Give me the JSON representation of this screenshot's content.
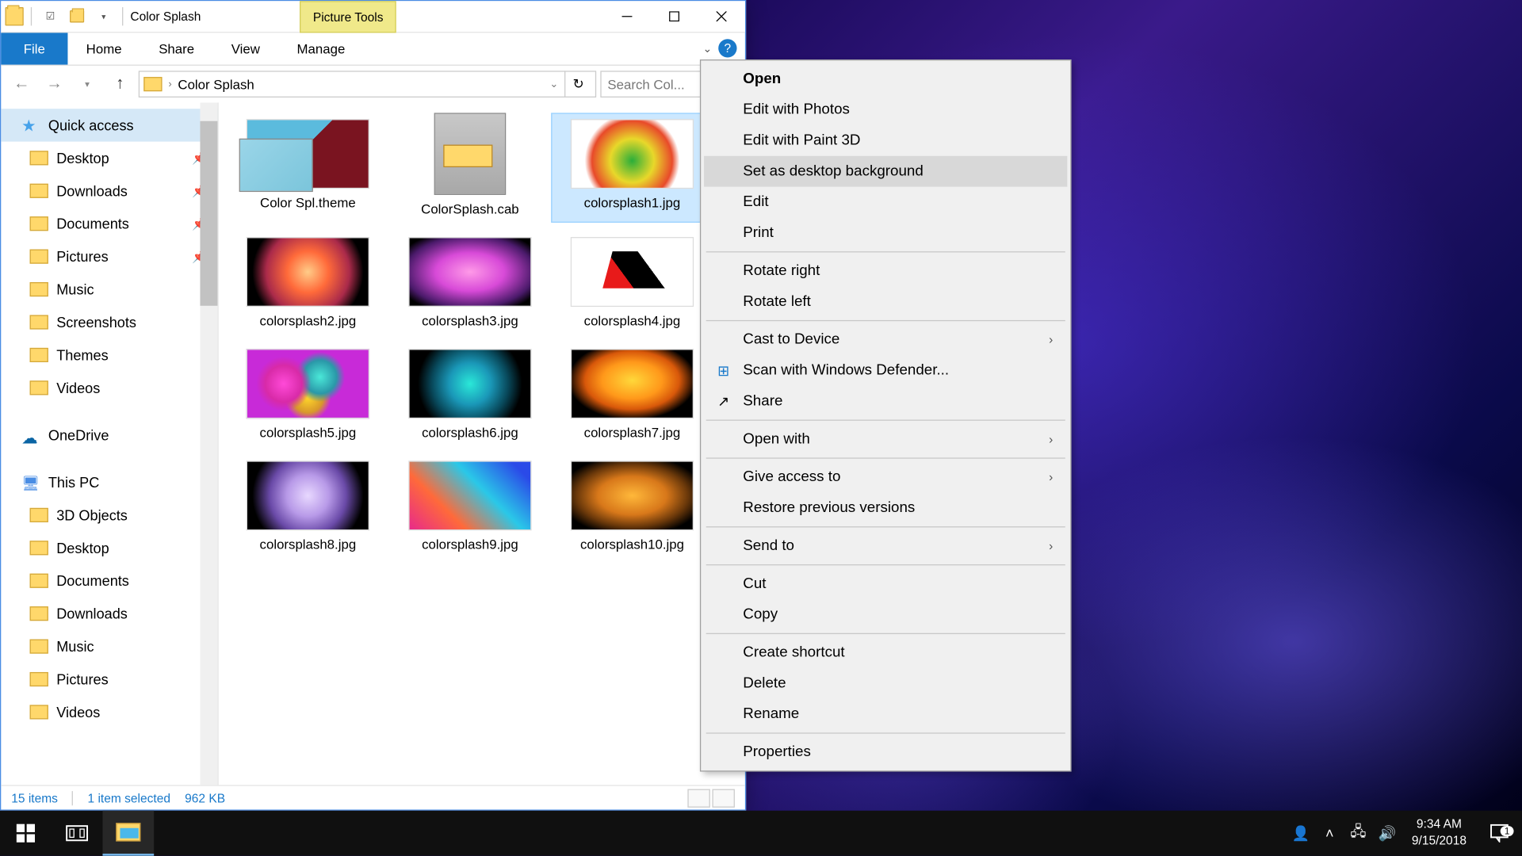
{
  "window": {
    "title": "Color Splash",
    "picture_tools": "Picture Tools"
  },
  "ribbon": {
    "file": "File",
    "tabs": [
      "Home",
      "Share",
      "View",
      "Manage"
    ]
  },
  "address": {
    "path": "Color Splash",
    "search_placeholder": "Search Col..."
  },
  "nav": {
    "quick_access": "Quick access",
    "pinned": [
      {
        "label": "Desktop"
      },
      {
        "label": "Downloads"
      },
      {
        "label": "Documents"
      },
      {
        "label": "Pictures"
      }
    ],
    "recent": [
      {
        "label": "Music"
      },
      {
        "label": "Screenshots"
      },
      {
        "label": "Themes"
      },
      {
        "label": "Videos"
      }
    ],
    "onedrive": "OneDrive",
    "this_pc": "This PC",
    "pc_items": [
      {
        "label": "3D Objects"
      },
      {
        "label": "Desktop"
      },
      {
        "label": "Documents"
      },
      {
        "label": "Downloads"
      },
      {
        "label": "Music"
      },
      {
        "label": "Pictures"
      },
      {
        "label": "Videos"
      }
    ]
  },
  "items": [
    {
      "label": "Color Spl.theme",
      "kind": "theme"
    },
    {
      "label": "ColorSplash.cab",
      "kind": "cab"
    },
    {
      "label": "colorsplash1.jpg",
      "kind": "img",
      "selected": true
    },
    {
      "label": "colorsplash2.jpg",
      "kind": "img"
    },
    {
      "label": "colorsplash3.jpg",
      "kind": "img"
    },
    {
      "label": "colorsplash4.jpg",
      "kind": "img"
    },
    {
      "label": "colorsplash5.jpg",
      "kind": "img"
    },
    {
      "label": "colorsplash6.jpg",
      "kind": "img"
    },
    {
      "label": "colorsplash7.jpg",
      "kind": "img"
    },
    {
      "label": "colorsplash8.jpg",
      "kind": "img"
    },
    {
      "label": "colorsplash9.jpg",
      "kind": "img"
    },
    {
      "label": "colorsplash10.jpg",
      "kind": "img"
    }
  ],
  "status": {
    "count": "15 items",
    "selected": "1 item selected",
    "size": "962 KB"
  },
  "ctx": {
    "open": "Open",
    "edit_photos": "Edit with Photos",
    "edit_paint3d": "Edit with Paint 3D",
    "set_bg": "Set as desktop background",
    "edit": "Edit",
    "print": "Print",
    "rot_r": "Rotate right",
    "rot_l": "Rotate left",
    "cast": "Cast to Device",
    "defender": "Scan with Windows Defender...",
    "share": "Share",
    "open_with": "Open with",
    "give_access": "Give access to",
    "restore": "Restore previous versions",
    "send_to": "Send to",
    "cut": "Cut",
    "copy": "Copy",
    "shortcut": "Create shortcut",
    "delete": "Delete",
    "rename": "Rename",
    "properties": "Properties"
  },
  "tray": {
    "time": "9:34 AM",
    "date": "9/15/2018",
    "notif_count": "1"
  }
}
